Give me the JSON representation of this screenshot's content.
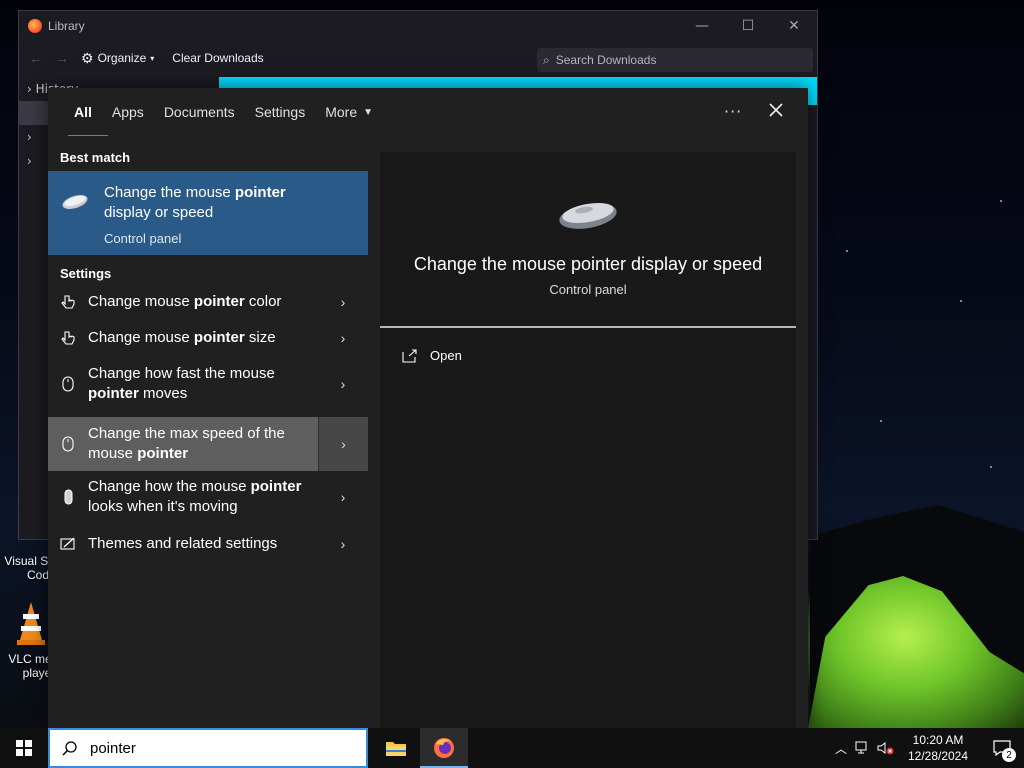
{
  "desktop": {
    "icons": [
      {
        "label": "Visual St... Code",
        "line1": "Visual St",
        "line2": "Cod"
      },
      {
        "label": "VLC media player",
        "line1": "VLC me",
        "line2": "playe"
      }
    ]
  },
  "library_window": {
    "title": "Library",
    "toolbar": {
      "organize_label": "Organize",
      "clear_label": "Clear Downloads"
    },
    "search_placeholder": "Search Downloads",
    "sidebar_item": "History"
  },
  "search_panel": {
    "tabs": [
      {
        "label": "All",
        "active": true
      },
      {
        "label": "Apps"
      },
      {
        "label": "Documents"
      },
      {
        "label": "Settings"
      },
      {
        "label": "More"
      }
    ],
    "best_match_heading": "Best match",
    "best_match": {
      "title_pre": "Change the mouse ",
      "title_bold": "pointer",
      "title_post": " display or speed",
      "subtitle": "Control panel"
    },
    "settings_heading": "Settings",
    "settings_items": [
      {
        "pre": "Change mouse ",
        "bold": "pointer",
        "post": " color",
        "icon": "pointer-color-icon"
      },
      {
        "pre": "Change mouse ",
        "bold": "pointer",
        "post": " size",
        "icon": "pointer-size-icon"
      },
      {
        "pre": "Change how fast the mouse ",
        "bold": "pointer",
        "post": " moves",
        "icon": "mouse-icon"
      },
      {
        "pre": "Change the max speed of the mouse ",
        "bold": "pointer",
        "post": "",
        "icon": "mouse-icon",
        "highlighted": true
      },
      {
        "pre": "Change how the mouse ",
        "bold": "pointer",
        "post": " looks when it's moving",
        "icon": "mouse-trail-icon"
      },
      {
        "pre": "Themes and related settings",
        "bold": "",
        "post": "",
        "icon": "themes-icon"
      }
    ],
    "preview": {
      "title": "Change the mouse pointer display or speed",
      "subtitle": "Control panel",
      "open_label": "Open"
    }
  },
  "taskbar": {
    "search_value": "pointer",
    "clock_time": "10:20 AM",
    "clock_date": "12/28/2024",
    "notification_count": "2"
  },
  "colors": {
    "accent": "#3a8bd9",
    "best_match_bg": "#2a5a88",
    "panel_bg": "#202020",
    "highlight_bg": "#5e5e5e"
  }
}
